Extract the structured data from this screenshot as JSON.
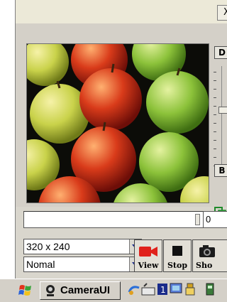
{
  "window": {
    "close_label": "X"
  },
  "side_panel": {
    "top_button_label": "D",
    "bottom_button_label": "B"
  },
  "progress": {
    "position_label": "0"
  },
  "controls": {
    "resolution": {
      "value": "320 x 240"
    },
    "mode": {
      "value": "Nomal"
    },
    "view_label": "View",
    "stop_label": "Stop",
    "shot_label": "Sho"
  },
  "taskbar": {
    "app_label": "CameraUI"
  },
  "colors": {
    "window_bg": "#d4d0c8",
    "record_icon": "#e0211b",
    "title_bg": "#ece9d8"
  }
}
